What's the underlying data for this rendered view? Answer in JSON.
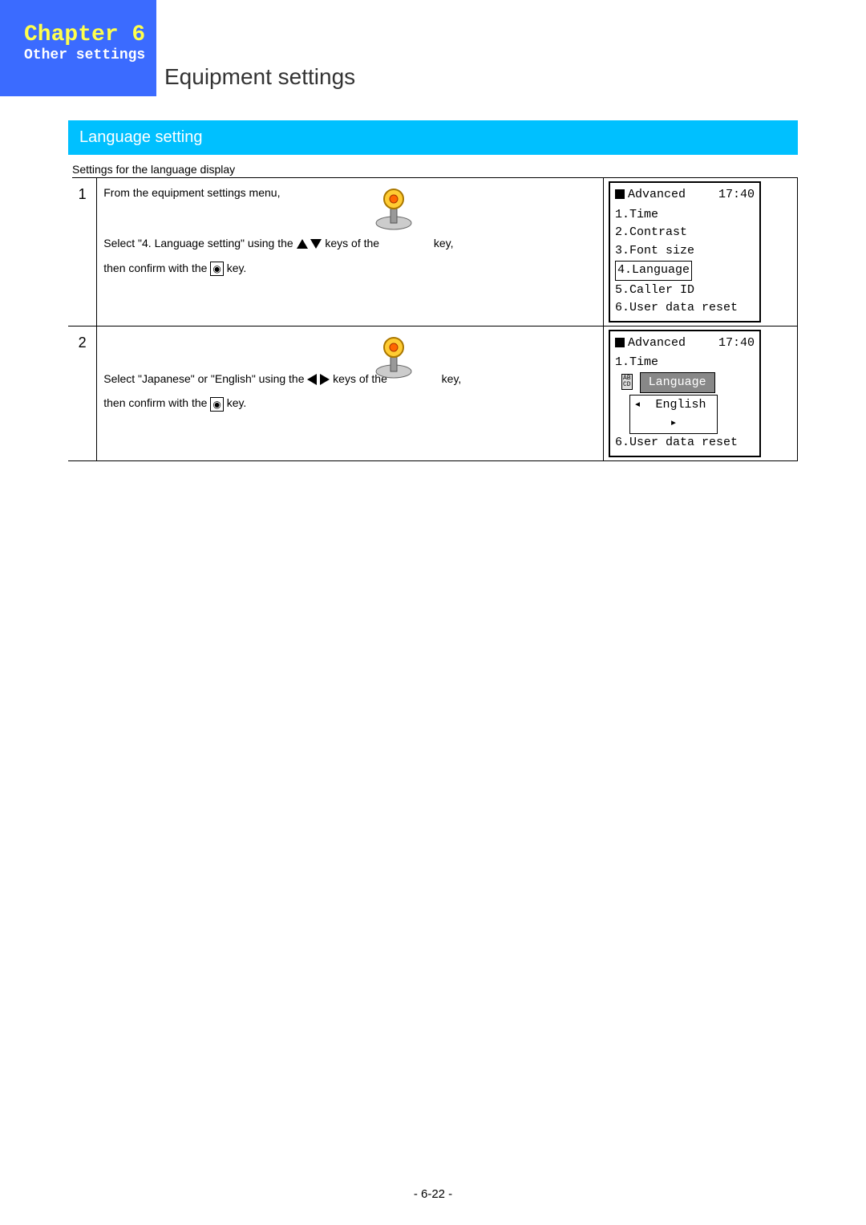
{
  "header": {
    "chapter": "Chapter 6",
    "subtitle": "Other settings",
    "page_title": "Equipment settings"
  },
  "section_title": "Language setting",
  "intro": "Settings for the language display",
  "steps": [
    {
      "num": "1",
      "line1": "From the equipment settings menu,",
      "select_pre": "Select \"4. Language setting\" using the ",
      "keys_of_the": " keys of the ",
      "key_word": " key,",
      "confirm_pre": "then confirm with the ",
      "key_word2": " key.",
      "screen": {
        "title": "Advanced",
        "time": "17:40",
        "items": [
          "1.Time",
          "2.Contrast",
          "3.Font size",
          "4.Language",
          "5.Caller ID",
          "6.User data reset"
        ],
        "selected_index": 3
      }
    },
    {
      "num": "2",
      "select_pre": "Select \"Japanese\" or \"English\" using the ",
      "keys_of_the": " keys of the ",
      "key_word": " key,",
      "confirm_pre": "then confirm with the ",
      "key_word2": " key.",
      "screen": {
        "title": "Advanced",
        "time": "17:40",
        "top_item": "1.Time",
        "popup_label": "Language",
        "value": "English",
        "bottom_item": "6.User data reset"
      }
    }
  ],
  "page_number": "- 6-22 -"
}
